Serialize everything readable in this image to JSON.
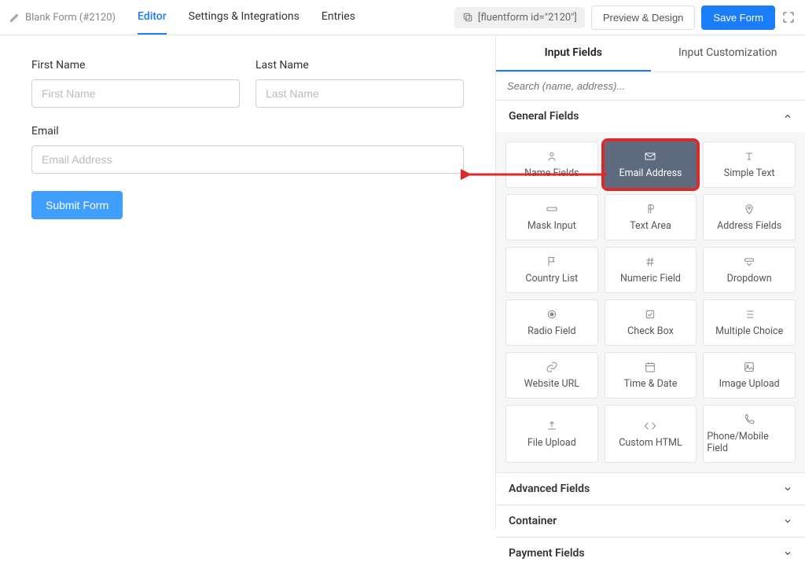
{
  "topbar": {
    "form_name": "Blank Form (#2120)",
    "tabs": {
      "editor": "Editor",
      "settings": "Settings & Integrations",
      "entries": "Entries"
    },
    "shortcode": "[fluentform id=\"2120\"]",
    "preview_btn": "Preview & Design",
    "save_btn": "Save Form"
  },
  "form": {
    "first_name_label": "First Name",
    "first_name_placeholder": "First Name",
    "last_name_label": "Last Name",
    "last_name_placeholder": "Last Name",
    "email_label": "Email",
    "email_placeholder": "Email Address",
    "submit_label": "Submit Form"
  },
  "sidebar": {
    "tabs": {
      "input_fields": "Input Fields",
      "customization": "Input Customization"
    },
    "search_placeholder": "Search (name, address)...",
    "sections": {
      "general": "General Fields",
      "advanced": "Advanced Fields",
      "container": "Container",
      "payment": "Payment Fields"
    },
    "fields": {
      "name_fields": "Name Fields",
      "email": "Email Address",
      "simple_text": "Simple Text",
      "mask_input": "Mask Input",
      "text_area": "Text Area",
      "address": "Address Fields",
      "country_list": "Country List",
      "numeric": "Numeric Field",
      "dropdown": "Dropdown",
      "radio": "Radio Field",
      "checkbox": "Check Box",
      "multiple_choice": "Multiple Choice",
      "website_url": "Website URL",
      "time_date": "Time & Date",
      "image_upload": "Image Upload",
      "file_upload": "File Upload",
      "custom_html": "Custom HTML",
      "phone": "Phone/Mobile Field"
    }
  }
}
